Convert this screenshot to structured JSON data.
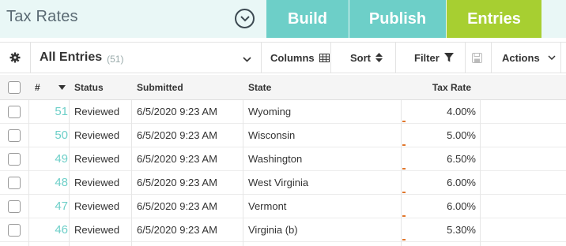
{
  "header": {
    "title": "Tax Rates",
    "tabs": [
      {
        "label": "Build"
      },
      {
        "label": "Publish"
      },
      {
        "label": "Entries"
      }
    ],
    "colors": {
      "tab_teal": "#6dcfc8",
      "tab_active": "#a7cf31",
      "bar_bg": "#e9f7f6"
    }
  },
  "toolbar": {
    "settings_icon": "gear-icon",
    "view_label": "All Entries",
    "view_count": "(51)",
    "columns_label": "Columns",
    "sort_label": "Sort",
    "filter_label": "Filter",
    "actions_label": "Actions"
  },
  "table": {
    "columns": [
      "#",
      "Status",
      "Submitted",
      "State",
      "Tax Rate"
    ],
    "rows": [
      {
        "id": "51",
        "status": "Reviewed",
        "submitted": "6/5/2020 9:23 AM",
        "state": "Wyoming",
        "tax": "4.00%"
      },
      {
        "id": "50",
        "status": "Reviewed",
        "submitted": "6/5/2020 9:23 AM",
        "state": "Wisconsin",
        "tax": "5.00%"
      },
      {
        "id": "49",
        "status": "Reviewed",
        "submitted": "6/5/2020 9:23 AM",
        "state": "Washington",
        "tax": "6.50%"
      },
      {
        "id": "48",
        "status": "Reviewed",
        "submitted": "6/5/2020 9:23 AM",
        "state": "West Virginia",
        "tax": "6.00%"
      },
      {
        "id": "47",
        "status": "Reviewed",
        "submitted": "6/5/2020 9:23 AM",
        "state": "Vermont",
        "tax": "6.00%"
      },
      {
        "id": "46",
        "status": "Reviewed",
        "submitted": "6/5/2020 9:23 AM",
        "state": "Virginia (b)",
        "tax": "5.30%"
      }
    ]
  }
}
